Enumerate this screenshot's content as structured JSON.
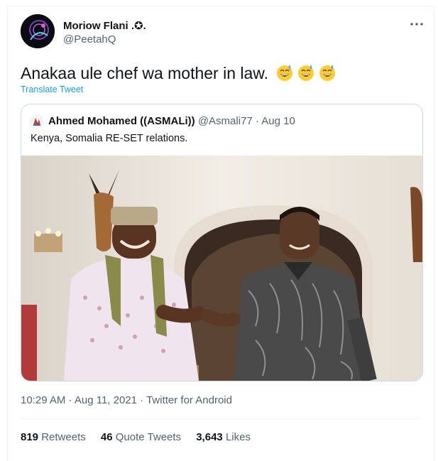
{
  "tweet": {
    "author": {
      "name": "Moriow Flani .✪.",
      "handle": "@PeetahQ"
    },
    "more_icon": "more-icon",
    "text": "Anakaa ule chef wa mother in law.",
    "emojis": [
      "grinning-sweat-emoji",
      "grinning-sweat-emoji",
      "grinning-sweat-emoji"
    ],
    "translate_label": "Translate Tweet",
    "meta": "10:29 AM · Aug 11, 2021 · Twitter for Android",
    "stats": {
      "retweets_count": "819",
      "retweets_label": "Retweets",
      "quotes_count": "46",
      "quotes_label": "Quote Tweets",
      "likes_count": "3,643",
      "likes_label": "Likes"
    }
  },
  "quoted": {
    "name": "Ahmed Mohamed ((ASMALi))",
    "handle": "@Asmali77",
    "date": "· Aug 10",
    "text": "Kenya, Somalia RE-SET relations."
  },
  "colors": {
    "link": "#1d9bf0",
    "secondary_text": "#536471",
    "primary_text": "#0f1419",
    "border": "#cfd9de"
  }
}
